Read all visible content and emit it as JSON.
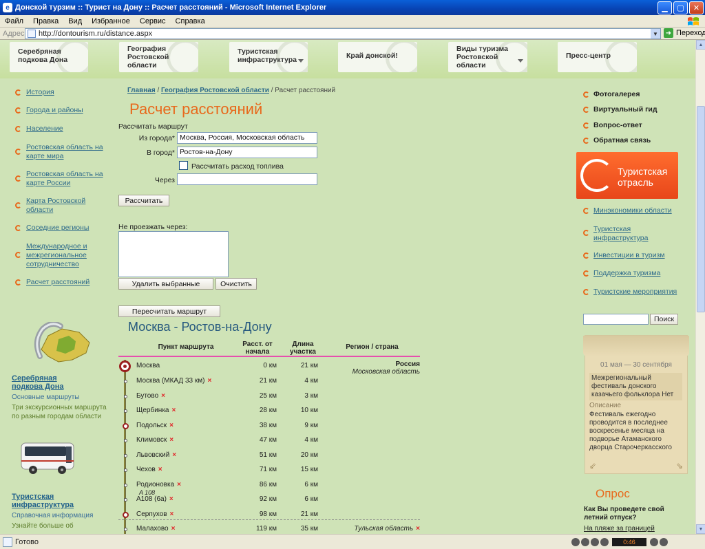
{
  "window": {
    "title": "Донской турзим :: Турист на Дону :: Расчет расстояний - Microsoft Internet Explorer",
    "icon": "ie-icon"
  },
  "menu": [
    "Файл",
    "Правка",
    "Вид",
    "Избранное",
    "Сервис",
    "Справка"
  ],
  "address": {
    "label": "Адрес",
    "url": "http://dontourism.ru/distance.aspx",
    "go_label": "Переход"
  },
  "nav": [
    {
      "label": "Серебряная подкова Дона",
      "has_dropdown": false
    },
    {
      "label": "География Ростовской области",
      "has_dropdown": false
    },
    {
      "label": "Туристская инфраструктура",
      "has_dropdown": true
    },
    {
      "label": "Край донской!",
      "has_dropdown": false
    },
    {
      "label": "Виды туризма Ростовской области",
      "has_dropdown": true
    },
    {
      "label": "Пресс-центр",
      "has_dropdown": false
    }
  ],
  "left_nav": [
    "История",
    "Города и районы",
    "Население",
    "Ростовская область на карте мира",
    "Ростовская область на карте России",
    "Карта Ростовской области",
    "Соседние регионы",
    "Международное и межрегиональное сотрудничество",
    "Расчет расстояний"
  ],
  "promo1": {
    "title": "Серебряная подкова Дона",
    "text1": "Основные маршруты",
    "text2": "Три экскурсионных маршрута по разным городам области"
  },
  "promo2": {
    "title": "Туристская инфраструктура",
    "text1": "Справочная информация",
    "text2": "Узнайте больше об"
  },
  "breadcrumb": {
    "home": "Главная",
    "sep": "/",
    "section": "География Ростовской области",
    "current": "Расчет расстояний"
  },
  "page_title": "Расчет расстояний",
  "form": {
    "section_label": "Рассчитать маршрут",
    "from_label": "Из города*",
    "from_value": "Москва, Россия, Московская область",
    "to_label": "В город*",
    "to_value": "Ростов-на-Дону",
    "fuel_label": "Рассчитать расход топлива",
    "via_label": "Через",
    "via_value": "",
    "calc_button": "Рассчитать",
    "avoid_label": "Не проезжать через:",
    "delete_button": "Удалить выбранные",
    "clear_button": "Очистить",
    "recalc_button": "Пересчитать маршрут"
  },
  "route": {
    "title": "Москва - Ростов-на-Дону",
    "headers": [
      "Пункт маршрута",
      "Расст. от начала",
      "Длина участка",
      "Регион / страна"
    ],
    "rows": [
      {
        "name": "Москва",
        "from_start": "0 км",
        "segment": "21 км",
        "country": "Россия",
        "region": "Московская область",
        "x": false,
        "marker": "big",
        "road": ""
      },
      {
        "name": "Москва (МКАД 33 км)",
        "from_start": "21 км",
        "segment": "4 км",
        "country": "",
        "region": "",
        "x": true,
        "marker": "tick",
        "road": ""
      },
      {
        "name": "Бутово",
        "from_start": "25 км",
        "segment": "3 км",
        "country": "",
        "region": "",
        "x": true,
        "marker": "tick",
        "road": ""
      },
      {
        "name": "Щербинка",
        "from_start": "28 км",
        "segment": "10 км",
        "country": "",
        "region": "",
        "x": true,
        "marker": "tick",
        "road": ""
      },
      {
        "name": "Подольск",
        "from_start": "38 км",
        "segment": "9 км",
        "country": "",
        "region": "",
        "x": true,
        "marker": "circle",
        "road": ""
      },
      {
        "name": "Климовск",
        "from_start": "47 км",
        "segment": "4 км",
        "country": "",
        "region": "",
        "x": true,
        "marker": "tick",
        "road": ""
      },
      {
        "name": "Львовский",
        "from_start": "51 км",
        "segment": "20 км",
        "country": "",
        "region": "",
        "x": true,
        "marker": "tick",
        "road": ""
      },
      {
        "name": "Чехов",
        "from_start": "71 км",
        "segment": "15 км",
        "country": "",
        "region": "",
        "x": true,
        "marker": "tick",
        "road": ""
      },
      {
        "name": "Родионовка",
        "from_start": "86 км",
        "segment": "6 км",
        "country": "",
        "region": "",
        "x": true,
        "marker": "tick",
        "road": "A 108"
      },
      {
        "name": "A108 (6а)",
        "from_start": "92 км",
        "segment": "6 км",
        "country": "",
        "region": "",
        "x": true,
        "marker": "tick",
        "road": ""
      },
      {
        "name": "Серпухов",
        "from_start": "98 км",
        "segment": "21 км",
        "country": "",
        "region": "",
        "x": true,
        "marker": "circle",
        "road": ""
      },
      {
        "name": "Малахово",
        "from_start": "119 км",
        "segment": "35 км",
        "country": "",
        "region": "Тульская область",
        "x": true,
        "marker": "tick",
        "road": ""
      }
    ]
  },
  "right_links_bold": [
    "Фотогалерея",
    "Виртуальный гид",
    "Вопрос-ответ",
    "Обратная связь"
  ],
  "banner": {
    "text": "Туристская отрасль"
  },
  "right_links": [
    "Минэкономики области",
    "Туристская инфраструктура",
    "Инвестиции в туризм",
    "Поддержка туризма",
    "Туристские мероприятия"
  ],
  "search": {
    "button": "Поиск",
    "value": ""
  },
  "event": {
    "date": "01 мая — 30 сентября",
    "title": "Межрегиональный фестиваль донского казачьего фольклора Нет",
    "desc_label": "Описание",
    "desc": "Фестиваль ежегодно проводится в последнее воскресенье месяца на подворье Атаманского дворца Старочеркасского"
  },
  "poll": {
    "title": "Опрос",
    "question": "Как Вы проведете свой летний отпуск?",
    "option1": "На пляже за границей"
  },
  "status": {
    "text": "Готово",
    "media_time": "0:46"
  },
  "colors": {
    "accent_orange": "#e8691c",
    "link": "#2d6a8a",
    "page_bg": "#cfe3b7",
    "route_line": "#f0e100",
    "marker": "#9b1f1f",
    "remove_x": "#e0262a"
  }
}
